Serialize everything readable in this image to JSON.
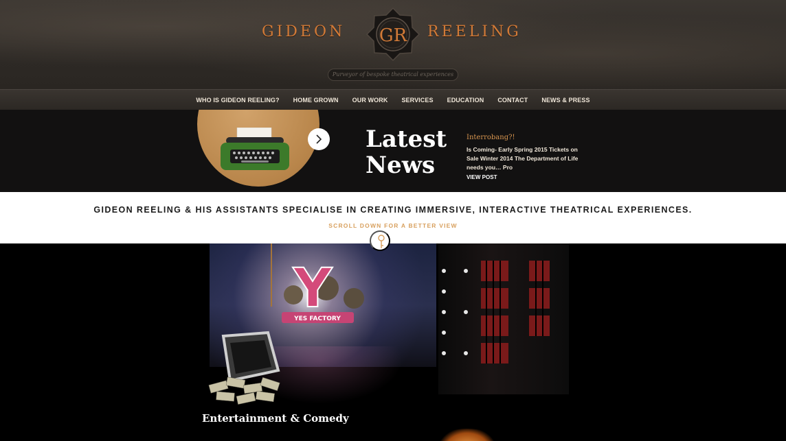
{
  "header": {
    "brand_left": "GIDEON",
    "brand_right": "REELING",
    "logo_monogram": "GR",
    "tagline": "Purveyor of bespoke theatrical experiences"
  },
  "nav": {
    "items": [
      {
        "label": "WHO IS GIDEON REELING?"
      },
      {
        "label": "HOME GROWN"
      },
      {
        "label": "OUR WORK"
      },
      {
        "label": "SERVICES"
      },
      {
        "label": "EDUCATION"
      },
      {
        "label": "CONTACT"
      },
      {
        "label": "NEWS & PRESS"
      }
    ]
  },
  "news": {
    "heading": "Latest News",
    "post_title": "Interrobang?!",
    "post_excerpt": "Is Coming- Early Spring 2015 Tickets on Sale Winter 2014 The Department of Life needs you… Pro",
    "view_post_label": "VIEW POST",
    "next_icon": "chevron-right-icon"
  },
  "intro": {
    "text": "GIDEON REELING & HIS ASSISTANTS SPECIALISE IN CREATING IMMERSIVE, INTERACTIVE THEATRICAL EXPERIENCES.",
    "scroll_hint": "SCROLL DOWN FOR A BETTER VIEW",
    "scroll_icon": "key-down-icon"
  },
  "showcase": {
    "sign_letter": "Y",
    "sign_caption": "YES FACTORY",
    "category_title": "Entertainment & Comedy"
  },
  "colors": {
    "brand_orange": "#d27a37",
    "accent_gold": "#d8a05e",
    "header_bg": "#2e2a26",
    "news_bg": "#121111"
  }
}
